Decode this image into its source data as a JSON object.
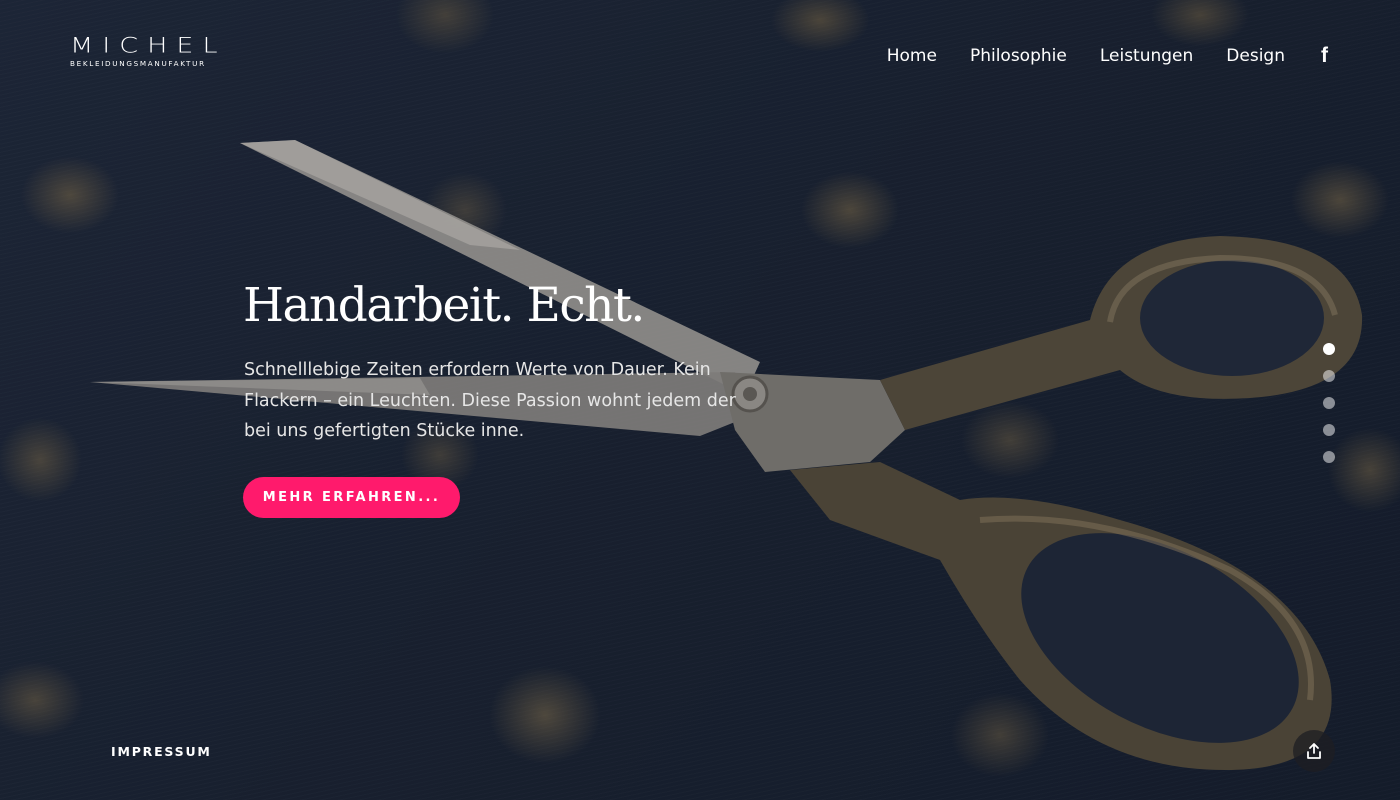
{
  "brand": {
    "name": "MICHEL",
    "tagline": "BEKLEIDUNGSMANUFAKTUR"
  },
  "nav": {
    "items": [
      {
        "label": "Home"
      },
      {
        "label": "Philosophie"
      },
      {
        "label": "Leistungen"
      },
      {
        "label": "Design"
      }
    ],
    "social_icon": "facebook-icon",
    "social_glyph": "f"
  },
  "hero": {
    "headline": "Handarbeit. Echt.",
    "intro": "Schnelllebige Zeiten erfordern Werte von Dauer. Kein Flackern – ein Leuchten. Diese Passion wohnt jedem der bei uns gefertigten Stücke inne.",
    "cta_label": "MEHR ERFAHREN...",
    "background_image": "scissors-on-fabric"
  },
  "slider": {
    "slide_count": 5,
    "active_index": 0
  },
  "footer": {
    "impressum_label": "IMPRESSUM",
    "share_icon": "share-icon"
  },
  "colors": {
    "accent": "#ff1a6c",
    "text": "#ffffff"
  }
}
